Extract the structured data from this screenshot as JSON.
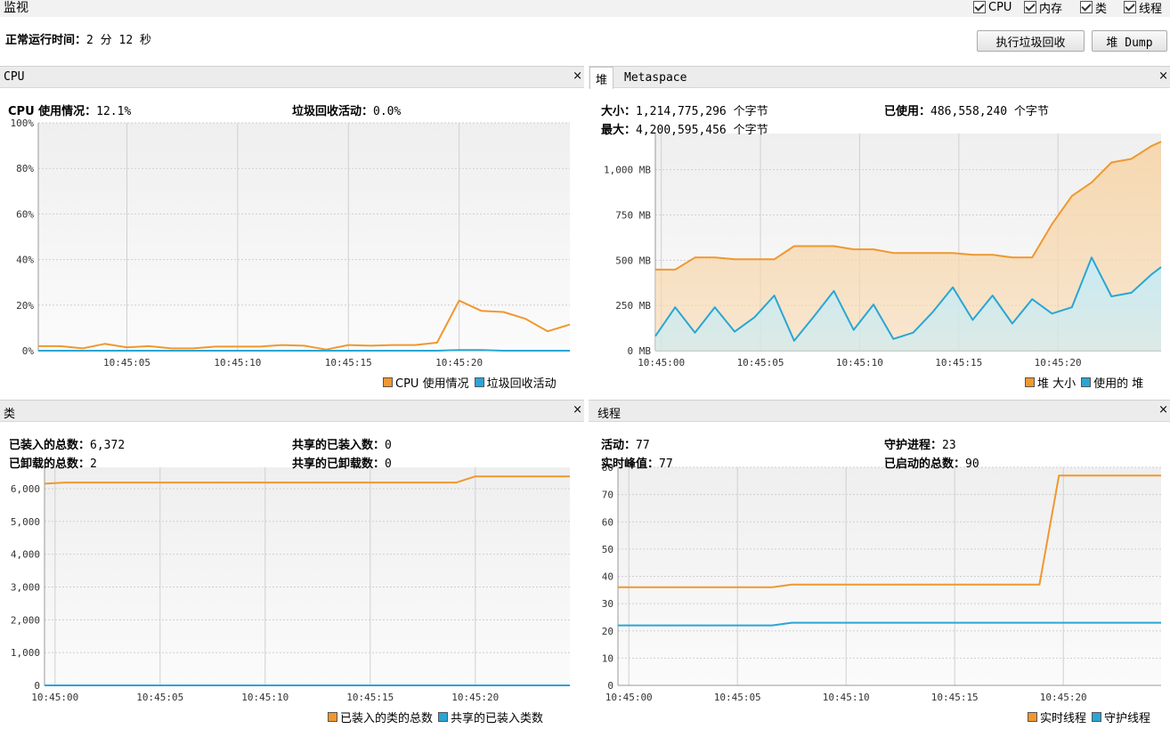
{
  "window": {
    "title": "监视",
    "checkboxes": [
      {
        "label": "CPU",
        "checked": true
      },
      {
        "label": "内存",
        "checked": true
      },
      {
        "label": "类",
        "checked": true
      },
      {
        "label": "线程",
        "checked": true
      }
    ],
    "uptime_label": "正常运行时间：",
    "uptime_value": "2 分 12 秒",
    "gc_button": "执行垃圾回收",
    "heap_dump_button": "堆 Dump"
  },
  "cpu": {
    "title": "CPU",
    "close": "×",
    "usage_label": "CPU 使用情况：",
    "usage_value": "12.1%",
    "gc_label": "垃圾回收活动：",
    "gc_value": "0.0%",
    "legend": [
      "CPU 使用情况",
      "垃圾回收活动"
    ]
  },
  "memory": {
    "tabs": [
      "堆",
      "Metaspace"
    ],
    "close": "×",
    "size_label": "大小：",
    "size_value": "1,214,775,296 个字节",
    "max_label": "最大：",
    "max_value": "4,200,595,456 个字节",
    "used_label": "已使用：",
    "used_value": "486,558,240 个字节",
    "legend": [
      "堆 大小",
      "使用的 堆"
    ]
  },
  "classes": {
    "title": "类",
    "close": "×",
    "loaded_label": "已装入的总数：",
    "loaded_value": "6,372",
    "unloaded_label": "已卸载的总数：",
    "unloaded_value": "2",
    "shared_loaded_label": "共享的已装入数：",
    "shared_loaded_value": "0",
    "shared_unloaded_label": "共享的已卸载数：",
    "shared_unloaded_value": "0",
    "legend": [
      "已装入的类的总数",
      "共享的已装入类数"
    ]
  },
  "threads": {
    "title": "线程",
    "close": "×",
    "live_label": "活动：",
    "live_value": "77",
    "peak_label": "实时峰值：",
    "peak_value": "77",
    "daemon_label": "守护进程：",
    "daemon_value": "23",
    "started_label": "已启动的总数：",
    "started_value": "90",
    "legend": [
      "实时线程",
      "守护线程"
    ]
  },
  "colors": {
    "orange": "#f0982f",
    "blue": "#2aa6d4",
    "orange_fill": "#f7d7ad",
    "blue_fill": "#c6ecf8"
  },
  "chart_data": [
    {
      "type": "line",
      "id": "cpu",
      "x_ticks": [
        "10:45:05",
        "10:45:10",
        "10:45:15",
        "10:45:20"
      ],
      "y_ticks": [
        "0%",
        "20%",
        "40%",
        "60%",
        "80%",
        "100%"
      ],
      "ylim": [
        0,
        100
      ],
      "time_range": [
        0.0,
        24.0
      ],
      "tick_times": [
        4.0,
        9.0,
        14.0,
        19.0
      ],
      "series": [
        {
          "name": "CPU 使用情况",
          "color": "#f0982f",
          "x": [
            0,
            1,
            2,
            3,
            4,
            5,
            6,
            7,
            8,
            9,
            10,
            11,
            12,
            13,
            14,
            15,
            16,
            17,
            18,
            19,
            20,
            21,
            22,
            23,
            24
          ],
          "values": [
            2,
            2,
            1,
            3,
            1.5,
            2,
            1,
            1,
            1.8,
            1.8,
            1.8,
            2.5,
            2.2,
            0.5,
            2.5,
            2.2,
            2.5,
            2.5,
            3.5,
            22,
            17.5,
            17,
            14,
            8.5,
            11.5
          ]
        },
        {
          "name": "垃圾回收活动",
          "color": "#2aa6d4",
          "x": [
            0,
            18,
            19,
            20,
            21,
            24
          ],
          "values": [
            0,
            0,
            0.3,
            0.3,
            0,
            0
          ]
        }
      ]
    },
    {
      "type": "area",
      "id": "heap",
      "x_ticks": [
        "10:45:00",
        "10:45:05",
        "10:45:10",
        "10:45:15",
        "10:45:20"
      ],
      "y_ticks": [
        "0 MB",
        "250 MB",
        "500 MB",
        "750 MB",
        "1,000 MB"
      ],
      "ylim": [
        0,
        1200
      ],
      "time_range": [
        -0.3,
        25.2
      ],
      "tick_times": [
        0,
        5,
        10,
        15,
        20
      ],
      "series": [
        {
          "name": "堆 大小",
          "color": "#f0982f",
          "x": [
            -0.3,
            0.7,
            1.7,
            2.7,
            3.7,
            4.7,
            5.7,
            6.7,
            7.7,
            8.7,
            9.7,
            10.7,
            11.7,
            12.7,
            13.7,
            14.7,
            15.7,
            16.7,
            17.7,
            18.7,
            19.7,
            20.7,
            21.7,
            22.7,
            23.7,
            24.7,
            25.2
          ],
          "values": [
            448,
            448,
            515,
            515,
            505,
            505,
            505,
            578,
            578,
            578,
            560,
            560,
            540,
            540,
            540,
            540,
            530,
            530,
            515,
            515,
            700,
            855,
            930,
            1040,
            1060,
            1130,
            1155
          ]
        },
        {
          "name": "使用的 堆",
          "color": "#2aa6d4",
          "x": [
            -0.3,
            0.7,
            1.7,
            2.7,
            3.7,
            4.7,
            5.7,
            6.7,
            7.7,
            8.7,
            9.7,
            10.7,
            11.7,
            12.7,
            13.7,
            14.7,
            15.7,
            16.7,
            17.7,
            18.7,
            19.7,
            20.7,
            21.7,
            22.7,
            23.7,
            24.7,
            25.2
          ],
          "values": [
            80,
            240,
            100,
            240,
            105,
            185,
            305,
            55,
            190,
            330,
            115,
            255,
            65,
            100,
            215,
            350,
            170,
            305,
            150,
            285,
            205,
            240,
            515,
            300,
            320,
            420,
            462
          ]
        }
      ]
    },
    {
      "type": "line",
      "id": "classes",
      "x_ticks": [
        "10:45:00",
        "10:45:05",
        "10:45:10",
        "10:45:15",
        "10:45:20"
      ],
      "y_ticks": [
        "0",
        "1,000",
        "2,000",
        "3,000",
        "4,000",
        "5,000",
        "6,000"
      ],
      "ylim": [
        0,
        6650
      ],
      "time_range": [
        -0.5,
        24.5
      ],
      "tick_times": [
        0,
        5,
        10,
        15,
        20
      ],
      "series": [
        {
          "name": "已装入的类的总数",
          "color": "#f0982f",
          "x": [
            -0.5,
            0.5,
            19.1,
            20.0,
            24.5
          ],
          "values": [
            6150,
            6185,
            6185,
            6372,
            6372
          ]
        },
        {
          "name": "共享的已装入类数",
          "color": "#2aa6d4",
          "x": [
            -0.5,
            24.5
          ],
          "values": [
            0,
            0
          ]
        }
      ]
    },
    {
      "type": "line",
      "id": "threads",
      "x_ticks": [
        "10:45:00",
        "10:45:05",
        "10:45:10",
        "10:45:15",
        "10:45:20"
      ],
      "y_ticks": [
        "0",
        "10",
        "20",
        "30",
        "40",
        "50",
        "60",
        "70",
        "80"
      ],
      "ylim": [
        0,
        80
      ],
      "time_range": [
        -0.5,
        24.5
      ],
      "tick_times": [
        0,
        5,
        10,
        15,
        20
      ],
      "series": [
        {
          "name": "实时线程",
          "color": "#f0982f",
          "x": [
            -0.5,
            6.6,
            7.5,
            18.9,
            19.8,
            24.5
          ],
          "values": [
            36,
            36,
            37,
            37,
            77,
            77
          ]
        },
        {
          "name": "守护线程",
          "color": "#2aa6d4",
          "x": [
            -0.5,
            6.6,
            7.5,
            24.5
          ],
          "values": [
            22,
            22,
            23,
            23
          ]
        }
      ]
    }
  ]
}
